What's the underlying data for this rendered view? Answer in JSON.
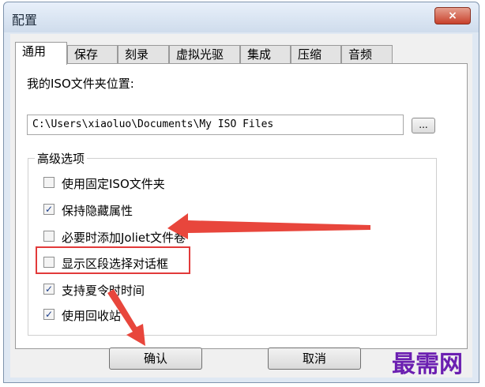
{
  "window": {
    "title": "配置",
    "close_icon": "×"
  },
  "tabs": [
    "通用",
    "保存",
    "刻录",
    "虚拟光驱",
    "集成",
    "压缩",
    "音频"
  ],
  "iso_folder": {
    "label": "我的ISO文件夹位置:",
    "value": "C:\\Users\\xiaoluo\\Documents\\My ISO Files",
    "browse_label": "..."
  },
  "advanced": {
    "title": "高级选项",
    "options": [
      {
        "label": "使用固定ISO文件夹",
        "checked": false
      },
      {
        "label": "保持隐藏属性",
        "checked": true
      },
      {
        "label": "必要时添加Joliet文件卷",
        "checked": false
      },
      {
        "label": "显示区段选择对话框",
        "checked": false
      },
      {
        "label": "支持夏令时时间",
        "checked": true
      },
      {
        "label": "使用回收站",
        "checked": true
      }
    ]
  },
  "buttons": {
    "ok": "确认",
    "cancel": "取消"
  },
  "watermark": "最需网",
  "annotation_color": "#e23a3a"
}
